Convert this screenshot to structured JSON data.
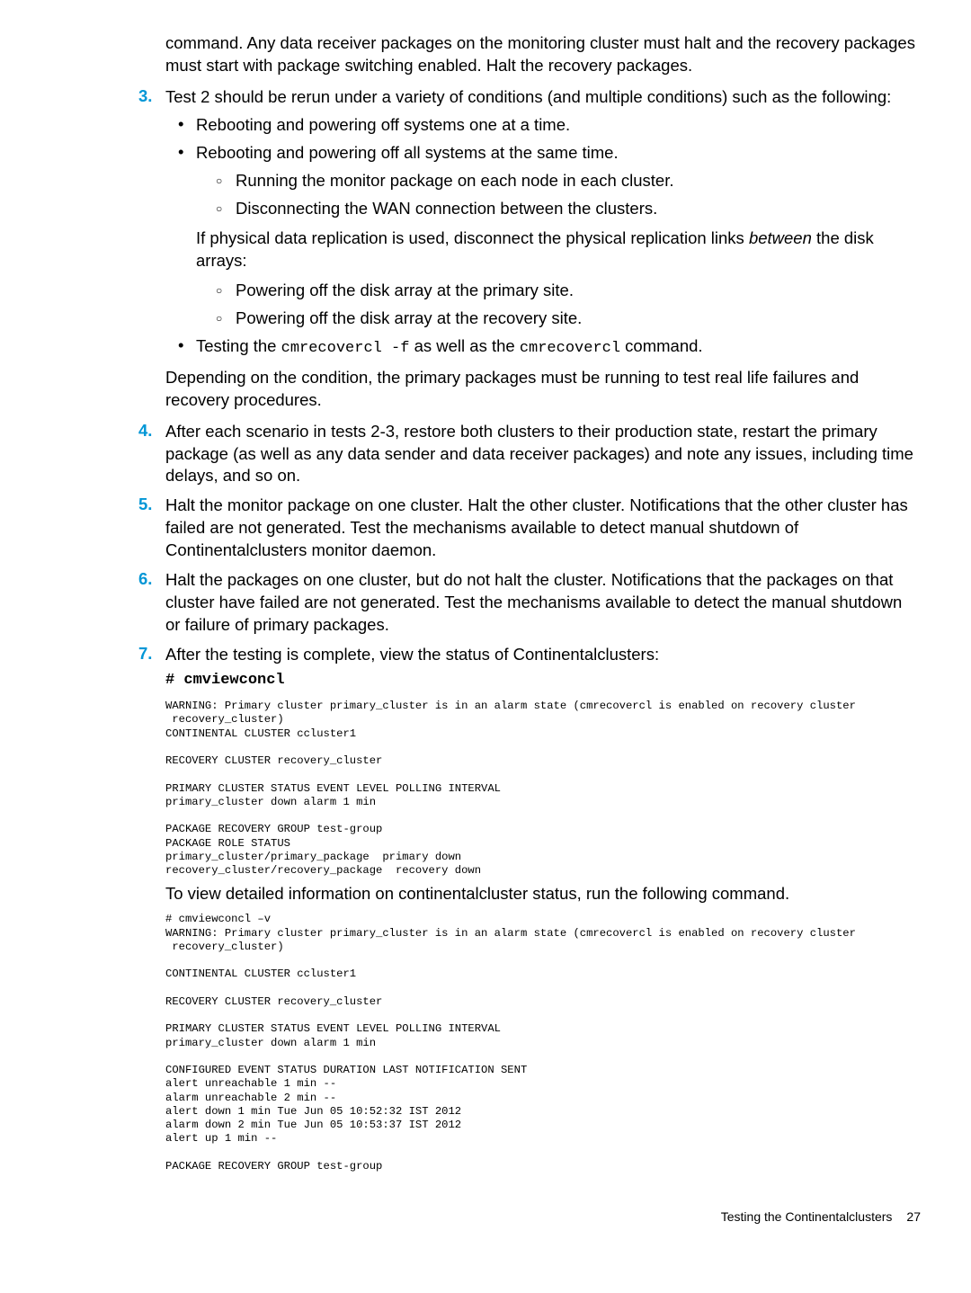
{
  "intro_cont": "command. Any data receiver packages on the monitoring cluster must halt and the recovery packages must start with package switching enabled. Halt the recovery packages.",
  "steps": {
    "3": {
      "text": "Test 2 should be rerun under a variety of conditions (and multiple conditions) such as the following:",
      "bullets": [
        "Rebooting and powering off systems one at a time.",
        "Rebooting and powering off all systems at the same time."
      ],
      "sub_bullets_a": [
        "Running the monitor package on each node in each cluster.",
        "Disconnecting the WAN connection between the clusters."
      ],
      "mid_para_pre": "If physical data replication is used, disconnect the physical replication links ",
      "mid_para_italic": "between",
      "mid_para_post": " the disk arrays:",
      "sub_bullets_b": [
        "Powering off the disk array at the primary site.",
        "Powering off the disk array at the recovery site."
      ],
      "last_bullet_pre": "Testing the ",
      "last_bullet_code1": "cmrecovercl -f",
      "last_bullet_mid": " as well as the ",
      "last_bullet_code2": "cmrecovercl",
      "last_bullet_post": " command.",
      "closing": "Depending on the condition, the primary packages must be running to test real life failures and recovery procedures."
    },
    "4": "After each scenario in tests 2-3, restore both clusters to their production state, restart the primary package (as well as any data sender and data receiver packages) and note any issues, including time delays, and so on.",
    "5": "Halt the monitor package on one cluster. Halt the other cluster. Notifications that the other cluster has failed are not generated. Test the mechanisms available to detect manual shutdown of Continentalclusters monitor daemon.",
    "6": "Halt the packages on one cluster, but do not halt the cluster. Notifications that the packages on that cluster have failed are not generated. Test the mechanisms available to detect the manual shutdown or failure of primary packages.",
    "7": "After the testing is complete, view the status of Continentalclusters:"
  },
  "cmd": "# cmviewconcl",
  "code1": "WARNING: Primary cluster primary_cluster is in an alarm state (cmrecovercl is enabled on recovery cluster\n recovery_cluster)\nCONTINENTAL CLUSTER ccluster1\n\nRECOVERY CLUSTER recovery_cluster\n\nPRIMARY CLUSTER STATUS EVENT LEVEL POLLING INTERVAL\nprimary_cluster down alarm 1 min\n\nPACKAGE RECOVERY GROUP test-group\nPACKAGE ROLE STATUS\nprimary_cluster/primary_package  primary down\nrecovery_cluster/recovery_package  recovery down",
  "inter_text": "To view detailed information on continentalcluster status, run the following command.",
  "code2": "# cmviewconcl –v\nWARNING: Primary cluster primary_cluster is in an alarm state (cmrecovercl is enabled on recovery cluster\n recovery_cluster)\n\nCONTINENTAL CLUSTER ccluster1\n\nRECOVERY CLUSTER recovery_cluster\n\nPRIMARY CLUSTER STATUS EVENT LEVEL POLLING INTERVAL\nprimary_cluster down alarm 1 min\n\nCONFIGURED EVENT STATUS DURATION LAST NOTIFICATION SENT\nalert unreachable 1 min --\nalarm unreachable 2 min --\nalert down 1 min Tue Jun 05 10:52:32 IST 2012\nalarm down 2 min Tue Jun 05 10:53:37 IST 2012\nalert up 1 min --\n\nPACKAGE RECOVERY GROUP test-group",
  "footer": {
    "title": "Testing the Continentalclusters",
    "page": "27"
  }
}
